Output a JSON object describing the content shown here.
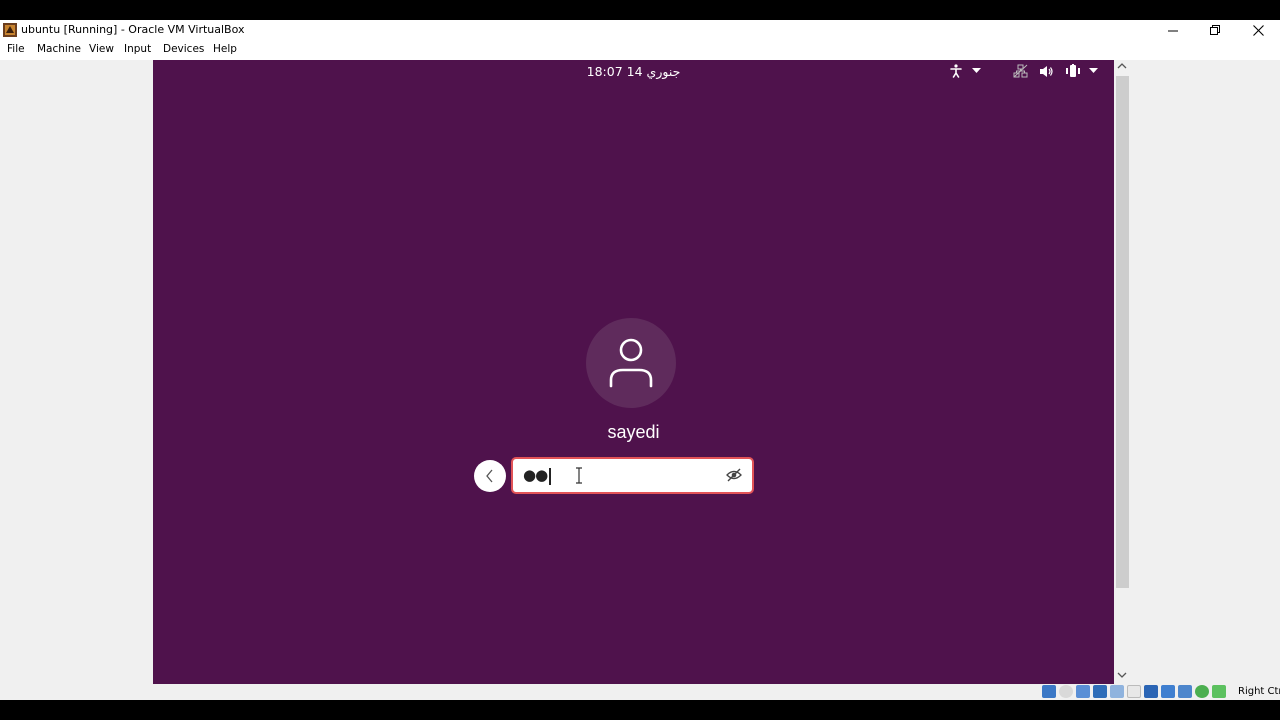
{
  "window": {
    "title": "ubuntu [Running] - Oracle VM VirtualBox"
  },
  "menu": {
    "items": [
      {
        "label": "File"
      },
      {
        "label": "Machine"
      },
      {
        "label": "View"
      },
      {
        "label": "Input"
      },
      {
        "label": "Devices"
      },
      {
        "label": "Help"
      }
    ]
  },
  "guest": {
    "clock": "جنوري 14  18:07",
    "username": "sayedi",
    "password_mask": "●●",
    "background_color": "#4f124c",
    "field_border_color": "#e25357",
    "tray_icons": [
      "accessibility-icon",
      "chevron-down-icon",
      "network-icon",
      "volume-icon",
      "battery-icon",
      "chevron-down-icon"
    ]
  },
  "statusbar": {
    "host_key": "Right Ctrl",
    "icons": [
      "hard-disk-icon",
      "optical-drive-icon",
      "audio-icon",
      "network-icon",
      "usb-icon",
      "shared-folder-icon",
      "display-icon",
      "video-capture-icon",
      "recording-icon",
      "cpu-icon",
      "mouse-integration-icon"
    ]
  }
}
